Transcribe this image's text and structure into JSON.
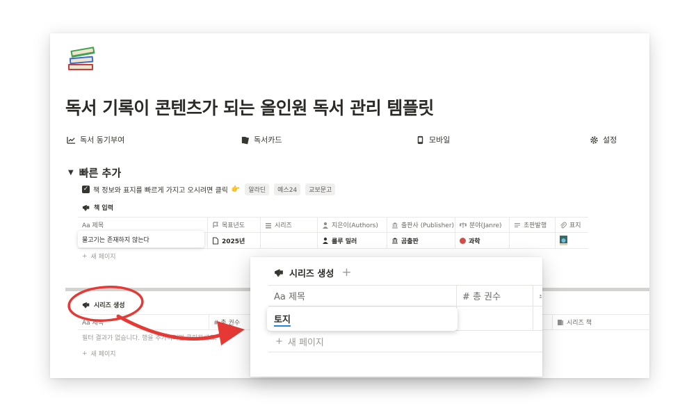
{
  "page": {
    "title": "독서 기록이 콘텐츠가 되는 올인원 독서 관리 템플릿",
    "icon": "books-icon"
  },
  "nav": [
    {
      "label": "독서 동기부여",
      "icon": "trending-up-icon"
    },
    {
      "label": "독서카드",
      "icon": "cards-icon"
    },
    {
      "label": "모바일",
      "icon": "mobile-icon"
    },
    {
      "label": "설정",
      "icon": "gear-icon"
    }
  ],
  "quick_add": {
    "toggle_label": "빠른 추가",
    "todo_text": "책 정보와 표지를 빠르게 가지고 오시려면 클릭",
    "todo_emoji": "👉",
    "chips": [
      "알라딘",
      "예스24",
      "교보문고"
    ]
  },
  "book_input": {
    "title": "책 입력",
    "columns": [
      {
        "label": "Aa 제목",
        "icon": ""
      },
      {
        "label": "목표년도",
        "icon": "flag-icon"
      },
      {
        "label": "시리즈",
        "icon": "stack-icon"
      },
      {
        "label": "지은이(Authors)",
        "icon": "person-icon"
      },
      {
        "label": "출판사 (Publisher)",
        "icon": "bank-icon"
      },
      {
        "label": "분야(Janre)",
        "icon": "scale-icon"
      },
      {
        "label": "초판발행",
        "icon": "lines-icon"
      },
      {
        "label": "표지",
        "icon": "paperclip-icon"
      }
    ],
    "row": {
      "title": "물고기는 존재하지 않는다",
      "year": "2025년",
      "author": "룰루 밀러",
      "publisher": "곰출판",
      "genre": "과학"
    },
    "new_page": "새 페이지"
  },
  "series_create": {
    "title": "시리즈 생성",
    "columns": [
      "Aa 제목",
      "# 총 권수",
      "시리즈 책"
    ],
    "empty_text": "필터 결과가 없습니다. 행을 추가하려면 클릭하세요.",
    "new_page": "새 페이지"
  },
  "zoom": {
    "title": "시리즈 생성",
    "plus": "+",
    "col_title": "Aa 제목",
    "col_count": "# 총 권수",
    "editing_value": "토지",
    "new_page": "새 페이지"
  },
  "colors": {
    "annotation_red": "#e53935",
    "genre_dot": "#d44c47"
  }
}
